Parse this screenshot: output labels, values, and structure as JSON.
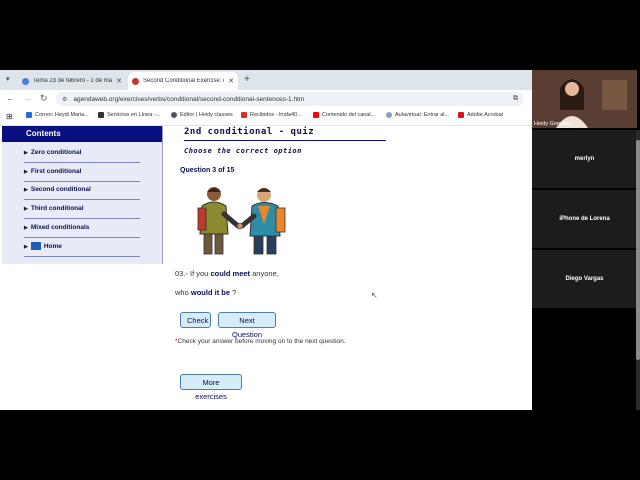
{
  "browser": {
    "tabs": [
      {
        "title": "Tema 23 de febrero - 1 de ma",
        "favicon_color": "#4a7fd8",
        "active": false
      },
      {
        "title": "Second Conditional Exercise: q",
        "favicon_color": "#c0392b",
        "active": true
      }
    ],
    "url": "agendaweb.org/exercises/verbs/conditional/second-conditional-sentences-1.htm",
    "bookmarks": [
      {
        "label": "Correo: Heydi Maria...",
        "icon_color": "#1e6fd9"
      },
      {
        "label": "Servicios en Línea -...",
        "icon_color": "#333333"
      },
      {
        "label": "Editor | Heidy classes",
        "icon_color": "#555555"
      },
      {
        "label": "Recibidos - lmda40...",
        "icon_color": "#d93025"
      },
      {
        "label": "Contenido del canal...",
        "icon_color": "#ff0000"
      },
      {
        "label": "Aulavirtual: Entrar al...",
        "icon_color": "#8aa0c0"
      },
      {
        "label": "Adobe Acrobat",
        "icon_color": "#d4191a"
      }
    ]
  },
  "sidebar": {
    "title": "Contents",
    "items": [
      {
        "label": "Zero conditional"
      },
      {
        "label": "First conditional"
      },
      {
        "label": "Second conditional"
      },
      {
        "label": "Third conditional"
      },
      {
        "label": "Mixed conditionals"
      },
      {
        "label": "Home"
      }
    ]
  },
  "quiz": {
    "title": "2nd conditional - quiz",
    "subtitle": "Choose the correct option",
    "question_counter": "Question 3 of 15",
    "sentence": {
      "prefix": "03.- If you",
      "verb1": "could meet",
      "mid": "anyone,",
      "line2_prefix": "who",
      "verb2": "would it be",
      "suffix": "?"
    },
    "check_label": "Check",
    "next_label": "Next Question",
    "note_star": "*",
    "note": "Check your answer before moving on to the next question.",
    "more_label": "More exercises"
  },
  "participants": [
    {
      "name": "Heidy González"
    },
    {
      "name": "merlyn"
    },
    {
      "name": "iPhone de Lorena"
    },
    {
      "name": "Diego Vargas"
    }
  ]
}
